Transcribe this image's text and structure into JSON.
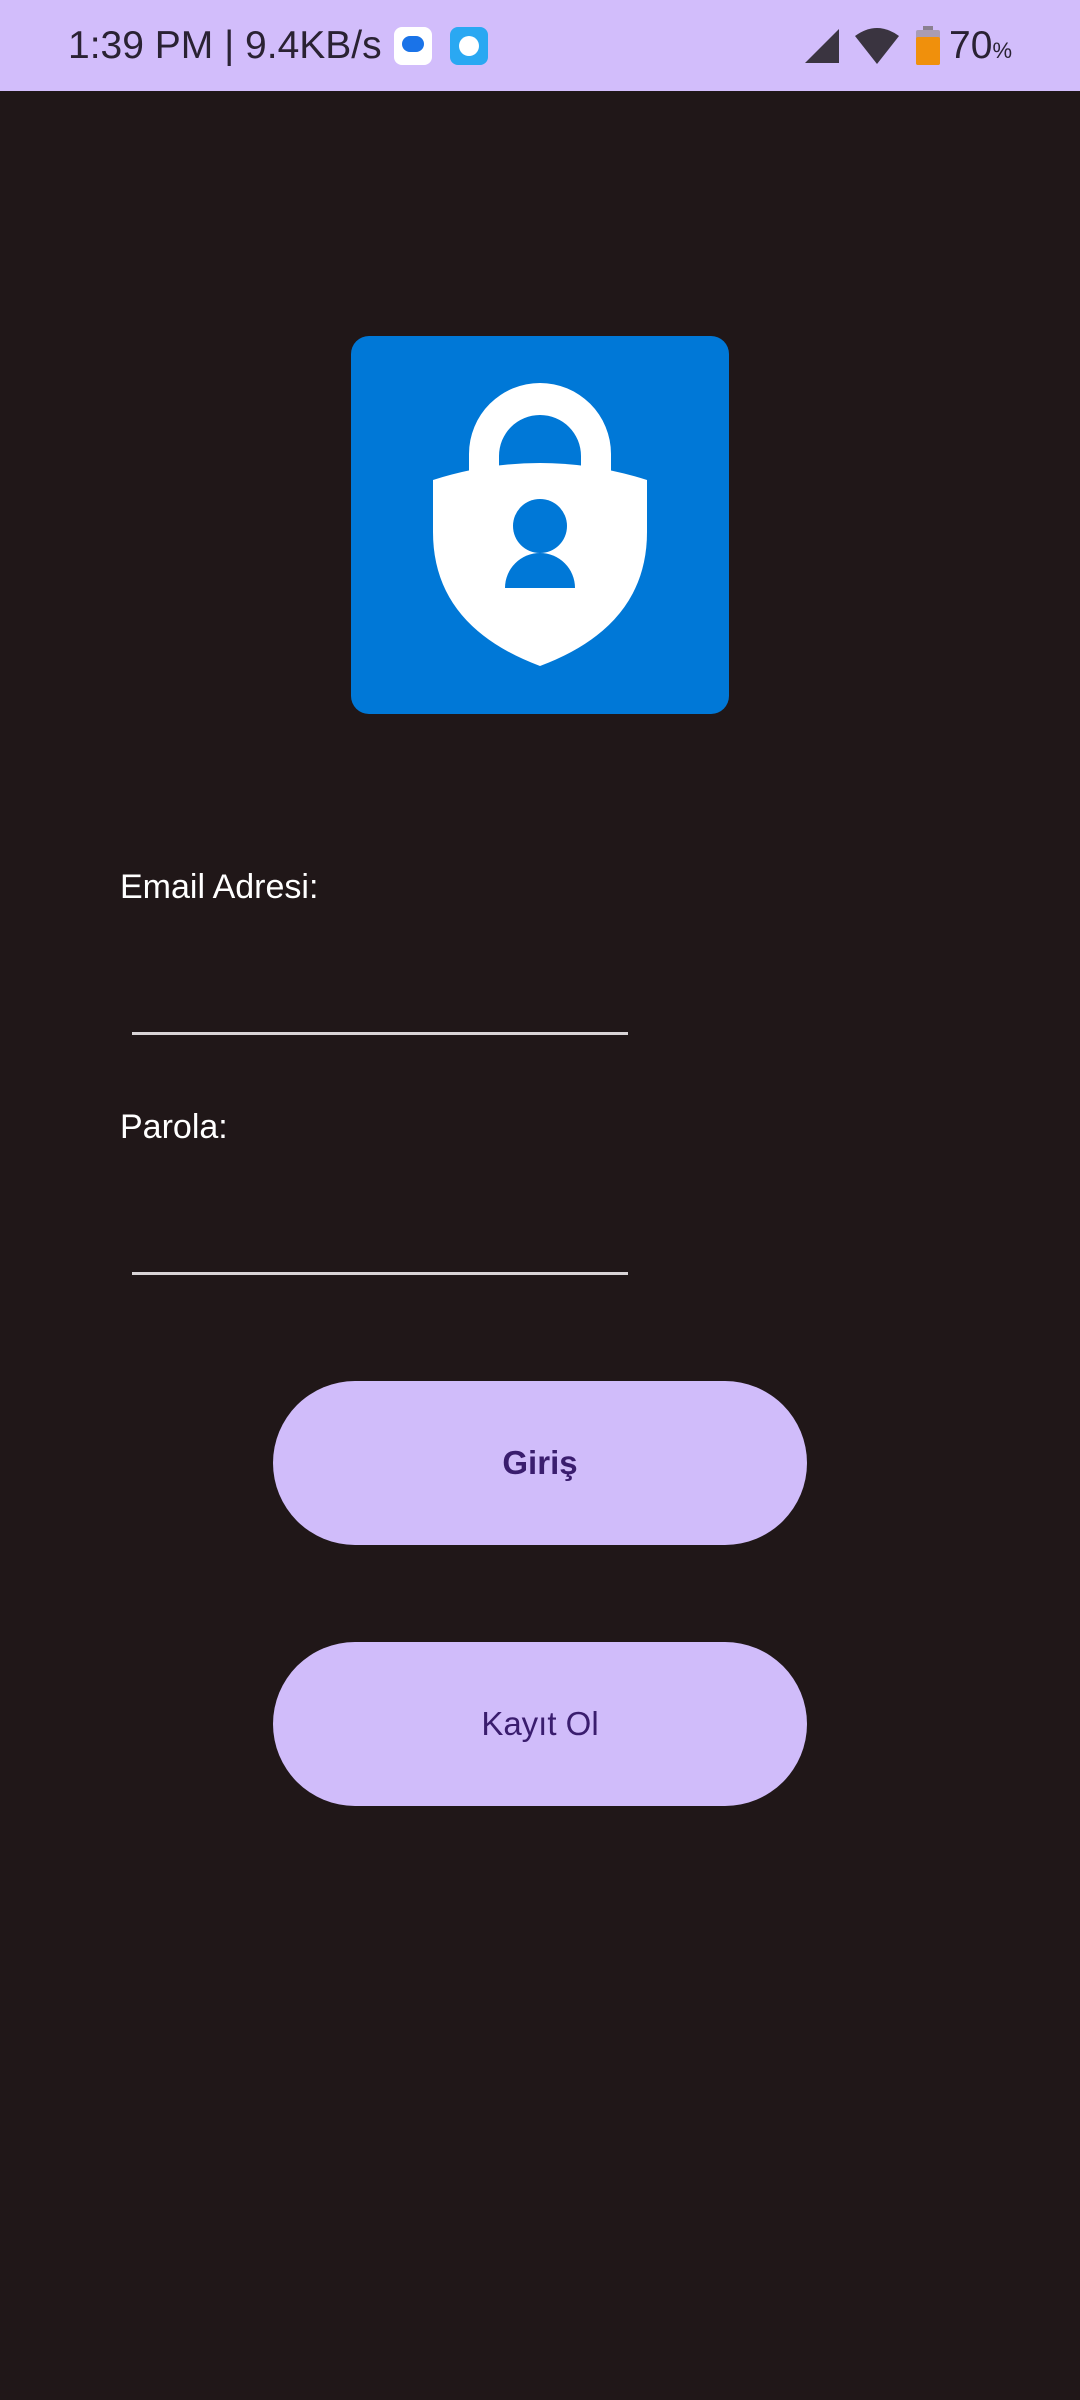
{
  "status_bar": {
    "time_speed": "1:39 PM | 9.4KB/s",
    "battery_value": "70",
    "battery_unit": "%",
    "icons": [
      "messages-icon",
      "chat-icon",
      "cell-signal-icon",
      "wifi-icon",
      "battery-icon"
    ],
    "background_color": "#d2bdfb"
  },
  "logo": {
    "icon": "authenticator-lock-icon",
    "background_color": "#0078d7"
  },
  "form": {
    "email_label": "Email Adresi:",
    "email_value": "",
    "password_label": "Parola:",
    "password_value": ""
  },
  "buttons": {
    "login_label": "Giriş",
    "register_label": "Kayıt Ol",
    "color": "#d0bcfa",
    "text_color": "#3a1d6e"
  },
  "page_background": "#201718"
}
